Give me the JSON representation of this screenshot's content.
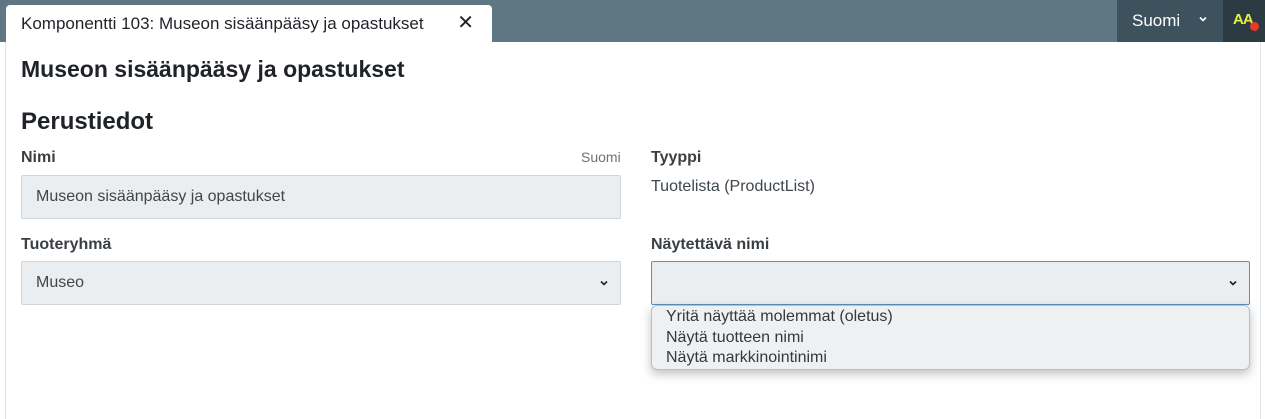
{
  "tab": {
    "label": "Komponentti 103: Museon sisäänpääsy ja opastukset",
    "close_symbol": "✕"
  },
  "header": {
    "language": "Suomi",
    "accessibility_label": "AA"
  },
  "page": {
    "title": "Museon sisäänpääsy ja opastukset",
    "section_title": "Perustiedot"
  },
  "form": {
    "name": {
      "label": "Nimi",
      "language": "Suomi",
      "value": "Museon sisäänpääsy ja opastukset"
    },
    "type": {
      "label": "Tyyppi",
      "value": "Tuotelista (ProductList)"
    },
    "product_group": {
      "label": "Tuoteryhmä",
      "value": "Museo"
    },
    "display_name": {
      "label": "Näytettävä nimi",
      "value": "",
      "options": [
        "Yritä näyttää molemmat (oletus)",
        "Näytä tuotteen nimi",
        "Näytä markkinointinimi"
      ]
    }
  },
  "icons": {
    "close": "close-icon",
    "chevron": "chevron-down-icon",
    "accessibility": "accessibility-icon"
  },
  "colors": {
    "topbar": "#5f7783",
    "language_bg": "#3d525c",
    "aa_bg": "#2c3b42",
    "aa_text": "#e6f03a",
    "notification_dot": "#e8372c",
    "focus_border": "#5a8fc4"
  }
}
